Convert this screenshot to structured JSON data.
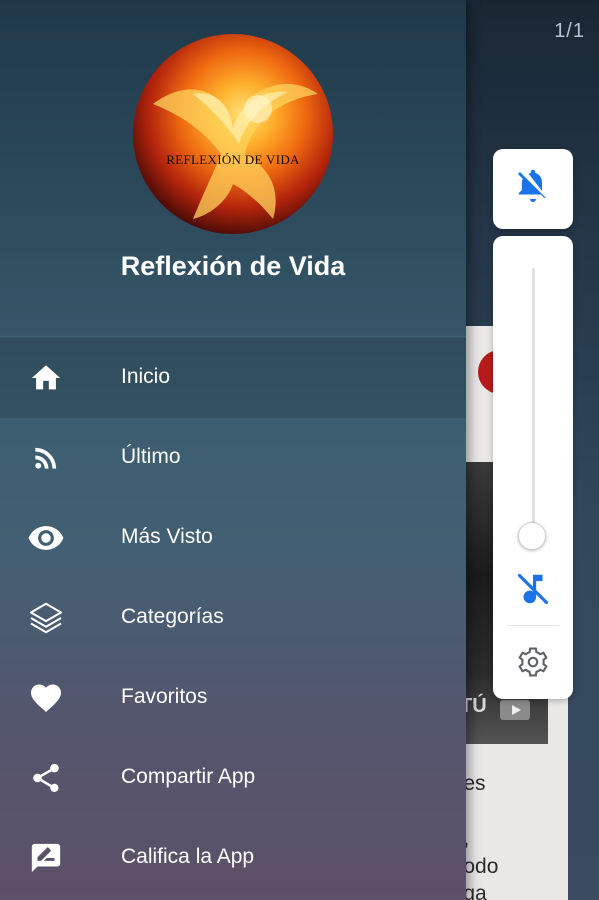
{
  "background_app": {
    "page_counter": "1/1",
    "card_caption": "TÚ",
    "text_lines": [
      "ones",
      "do,",
      "e todo",
      "enga"
    ]
  },
  "drawer": {
    "logo_text": "REFLEXIÓN DE VIDA",
    "title": "Reflexión de Vida",
    "items": [
      {
        "label": "Inicio",
        "icon": "home-icon"
      },
      {
        "label": "Último",
        "icon": "rss-icon"
      },
      {
        "label": "Más Visto",
        "icon": "eye-icon"
      },
      {
        "label": "Categorías",
        "icon": "layers-icon"
      },
      {
        "label": "Favoritos",
        "icon": "heart-icon"
      },
      {
        "label": "Compartir App",
        "icon": "share-icon"
      },
      {
        "label": "Califica la App",
        "icon": "rate-review-icon"
      }
    ],
    "active_index": 0
  },
  "volume_panel": {
    "ringer": "muted",
    "media_level": 0.0,
    "accent_color": "#1a73e8",
    "icons": [
      "bell-off-icon",
      "music-off-icon",
      "gear-icon"
    ]
  }
}
